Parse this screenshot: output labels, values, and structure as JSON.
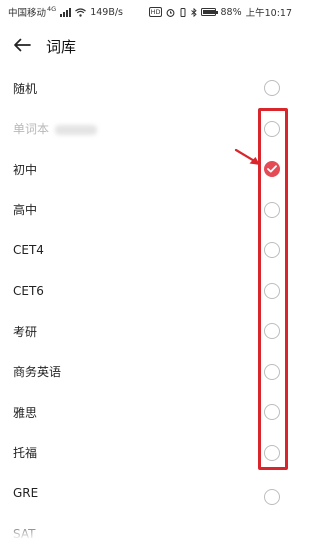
{
  "status_bar": {
    "carrier": "中国移动",
    "network": "4G",
    "speed": "149B/s",
    "hd": "HD",
    "battery": "88%",
    "battery_level": 0.88,
    "time": "上午10:17"
  },
  "header": {
    "back_icon": "arrow-left-icon",
    "title": "词库"
  },
  "list": {
    "items": [
      {
        "label": "随机",
        "selected": false,
        "disabled": false
      },
      {
        "label": "单词本",
        "selected": false,
        "disabled": true
      },
      {
        "label": "初中",
        "selected": true,
        "disabled": false
      },
      {
        "label": "高中",
        "selected": false,
        "disabled": false
      },
      {
        "label": "CET4",
        "selected": false,
        "disabled": false
      },
      {
        "label": "CET6",
        "selected": false,
        "disabled": false
      },
      {
        "label": "考研",
        "selected": false,
        "disabled": false
      },
      {
        "label": "商务英语",
        "selected": false,
        "disabled": false
      },
      {
        "label": "雅思",
        "selected": false,
        "disabled": false
      },
      {
        "label": "托福",
        "selected": false,
        "disabled": false
      },
      {
        "label": "GRE",
        "selected": false,
        "disabled": false
      },
      {
        "label": "SAT",
        "selected": false,
        "disabled": false
      }
    ]
  },
  "colors": {
    "accent": "#e54b55",
    "annotation": "#d9262c",
    "radio_border": "#bdbdbd",
    "disabled_text": "#b8b8b8"
  }
}
